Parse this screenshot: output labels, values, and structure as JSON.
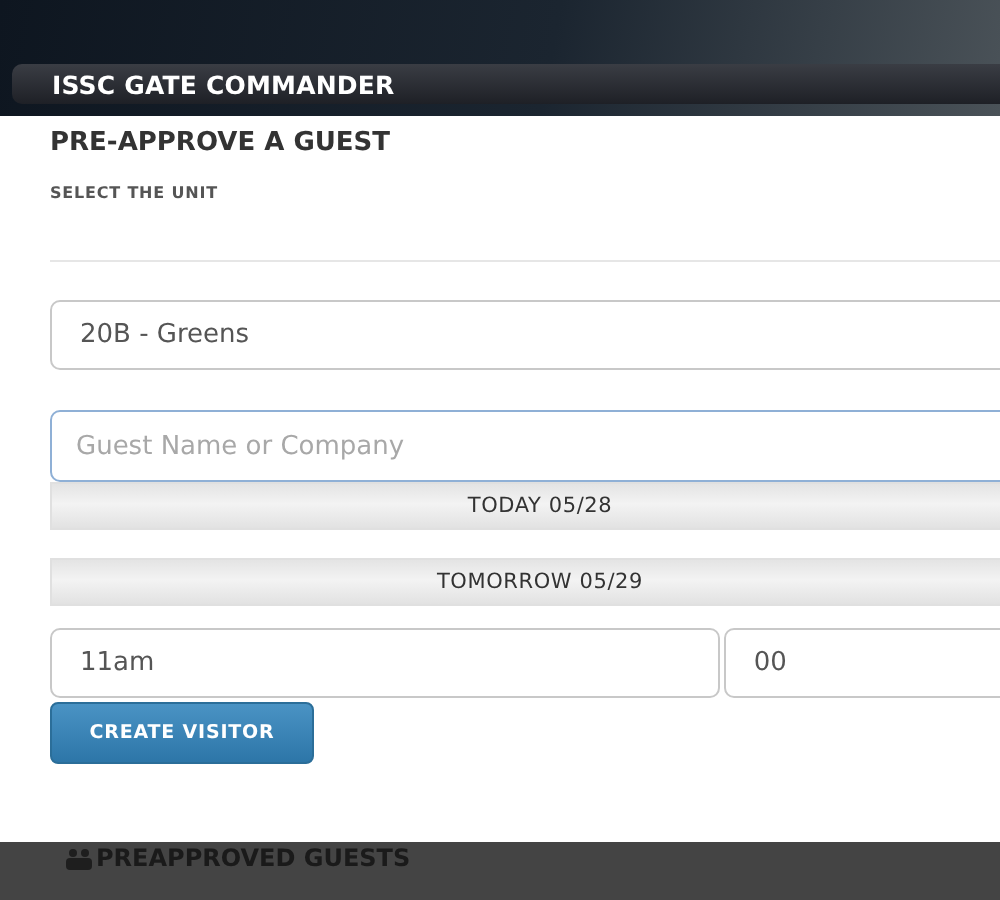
{
  "app_bar": {
    "title": "ISSC GATE COMMANDER"
  },
  "form": {
    "title": "PRE-APPROVE A GUEST",
    "unit_label": "SELECT THE UNIT",
    "unit_value": "20B - Greens",
    "guest_placeholder": "Guest Name or Company",
    "dates": [
      {
        "label": "TODAY 05/28"
      },
      {
        "label": "TOMORROW 05/29"
      }
    ],
    "hour": "11am",
    "minute": "00",
    "submit": "CREATE VISITOR"
  },
  "section": {
    "title": "PREAPPROVED GUESTS"
  }
}
